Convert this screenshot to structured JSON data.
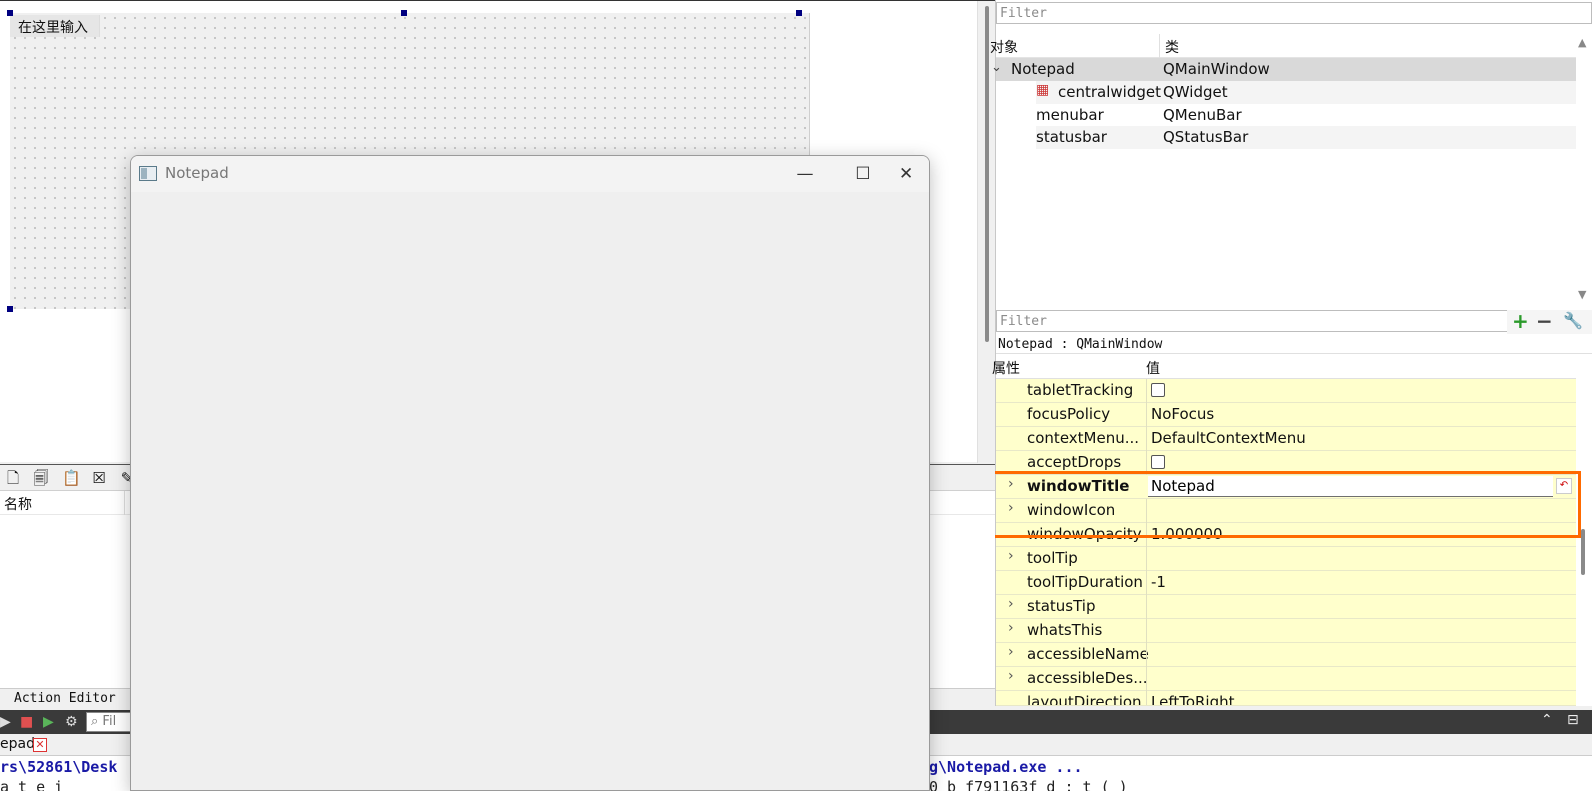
{
  "designer": {
    "menu_placeholder": "在这里输入"
  },
  "object_inspector": {
    "filter_placeholder": "Filter",
    "columns": [
      "对象",
      "类"
    ],
    "rows": [
      {
        "object": "Notepad",
        "class": "QMainWindow",
        "expanded": true
      },
      {
        "object": "centralwidget",
        "class": "QWidget"
      },
      {
        "object": "menubar",
        "class": "QMenuBar"
      },
      {
        "object": "statusbar",
        "class": "QStatusBar"
      }
    ]
  },
  "property_editor": {
    "filter_placeholder": "Filter",
    "class_line": "Notepad : QMainWindow",
    "columns": [
      "属性",
      "值"
    ],
    "rows": [
      {
        "name": "tabletTracking",
        "value": ""
      },
      {
        "name": "focusPolicy",
        "value": "NoFocus"
      },
      {
        "name": "contextMenu...",
        "value": "DefaultContextMenu"
      },
      {
        "name": "acceptDrops",
        "value": ""
      },
      {
        "name": "windowTitle",
        "value": "Notepad"
      },
      {
        "name": "windowIcon",
        "value": ""
      },
      {
        "name": "windowOpacity",
        "value": "1.000000"
      },
      {
        "name": "toolTip",
        "value": ""
      },
      {
        "name": "toolTipDuration",
        "value": "-1"
      },
      {
        "name": "statusTip",
        "value": ""
      },
      {
        "name": "whatsThis",
        "value": ""
      },
      {
        "name": "accessibleName",
        "value": ""
      },
      {
        "name": "accessibleDes...",
        "value": ""
      },
      {
        "name": "layoutDirection",
        "value": "LeftToRight"
      }
    ]
  },
  "action_editor": {
    "column_name": "名称",
    "tab_label": "Action Editor"
  },
  "output": {
    "filter_placeholder": "Fil",
    "tab_name": "epad",
    "line1_left": "rs\\52861\\Desk",
    "line1_right": "g\\Notepad.exe ...",
    "line2_left": "a t e i",
    "line2_right": "0 b f791163f d  : t ( )"
  },
  "preview_window": {
    "title": "Notepad",
    "minimize_glyph": "—",
    "maximize_glyph": "☐",
    "close_glyph": "✕"
  },
  "colors": {
    "highlight": "#ff6a00",
    "property_row_bg": "#ffffcc",
    "selection_handle": "#000080",
    "output_text": "#1a1aa6"
  }
}
